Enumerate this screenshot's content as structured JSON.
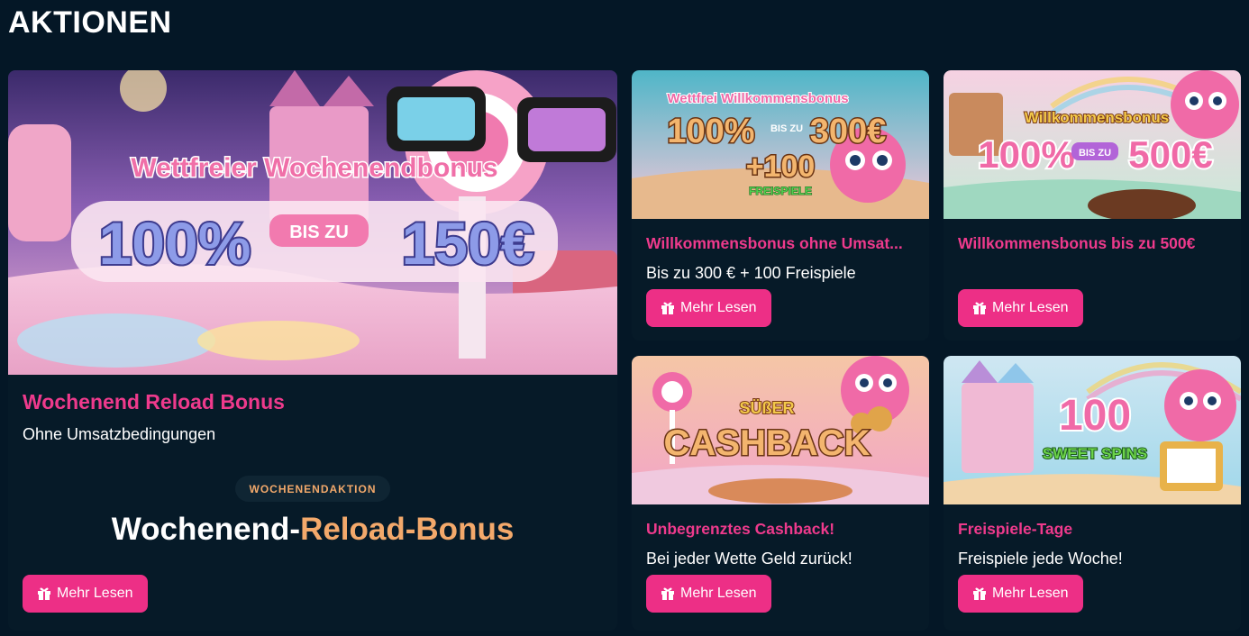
{
  "page": {
    "title": "AKTIONEN"
  },
  "featured": {
    "banner": {
      "line1": "Wettfreier Wochenendbonus",
      "pct": "100%",
      "bis": "BIS ZU",
      "amount": "150€"
    },
    "title": "Wochenend Reload Bonus",
    "subtitle": "Ohne Umsatzbedingungen",
    "pill": "WOCHENENDAKTION",
    "headline_a": "Wochenend-",
    "headline_b": "Reload-Bonus",
    "button": "Mehr Lesen"
  },
  "cards": [
    {
      "banner": {
        "line1": "Wettfrei Willkommensbonus",
        "pct": "100%",
        "bis": "BIS ZU",
        "amount": "300€",
        "extra": "+100",
        "extra2": "FREISPIELE"
      },
      "title": "Willkommensbonus ohne Umsat...",
      "subtitle": "Bis zu 300 € + 100 Freispiele",
      "button": "Mehr Lesen"
    },
    {
      "banner": {
        "line1": "Willkommensbonus",
        "pct": "100%",
        "bis": "BIS ZU",
        "amount": "500€"
      },
      "title": "Willkommensbonus bis zu 500€",
      "subtitle": "",
      "button": "Mehr Lesen"
    },
    {
      "banner": {
        "line1": "SÜßER",
        "big": "CASHBACK"
      },
      "title": "Unbegrenztes Cashback!",
      "subtitle": "Bei jeder Wette Geld zurück!",
      "button": "Mehr Lesen"
    },
    {
      "banner": {
        "big": "100",
        "line1": "SWEET SPINS"
      },
      "title": "Freispiele-Tage",
      "subtitle": "Freispiele jede Woche!",
      "button": "Mehr Lesen"
    }
  ],
  "colors": {
    "background": "#041726",
    "card": "#061a28",
    "accent": "#ed2f86",
    "title_pink": "#ee3a8c",
    "orange": "#f3a96b"
  },
  "icons": {
    "button_icon": "gift-icon"
  }
}
